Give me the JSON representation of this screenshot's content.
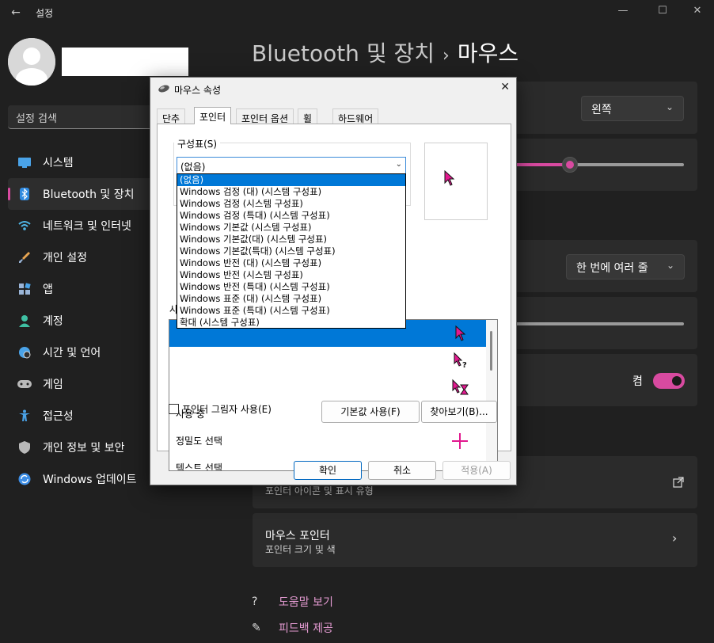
{
  "window": {
    "title": "설정",
    "back": "←",
    "controls": {
      "minimize": "—",
      "maximize": "☐",
      "close": "✕"
    }
  },
  "search": {
    "placeholder": "설정 검색"
  },
  "nav": {
    "items": [
      {
        "label": "시스템",
        "icon": "monitor-icon",
        "color": "#4aa3e8"
      },
      {
        "label": "Bluetooth 및 장치",
        "icon": "bluetooth-icon",
        "color": "#2f8ae0"
      },
      {
        "label": "네트워크 및 인터넷",
        "icon": "wifi-icon",
        "color": "#4fb7e8"
      },
      {
        "label": "개인 설정",
        "icon": "brush-icon",
        "color": "#e8a552"
      },
      {
        "label": "앱",
        "icon": "apps-icon",
        "color": "#9ab5d8"
      },
      {
        "label": "계정",
        "icon": "person-icon",
        "color": "#3fc0a3"
      },
      {
        "label": "시간 및 언어",
        "icon": "globe-clock-icon",
        "color": "#4aa3e8"
      },
      {
        "label": "게임",
        "icon": "gamepad-icon",
        "color": "#b9b9b9"
      },
      {
        "label": "접근성",
        "icon": "accessibility-icon",
        "color": "#4aa3e8"
      },
      {
        "label": "개인 정보 및 보안",
        "icon": "shield-icon",
        "color": "#b9b9b9"
      },
      {
        "label": "Windows 업데이트",
        "icon": "update-icon",
        "color": "#3d8ee6"
      }
    ],
    "active_index": 1
  },
  "page": {
    "crumb": "Bluetooth 및 장치",
    "separator": "›",
    "title": "마우스"
  },
  "settings": {
    "primary_button_value": "왼쪽",
    "pointer_speed": 0.33,
    "scroll_value": "한 번에 여러 줄",
    "toggle_label": "켬",
    "additional_sub": "포인터 아이콘 및 표시 유형",
    "mouse_pointer_title": "마우스 포인터",
    "mouse_pointer_sub": "포인터 크기 및 색"
  },
  "help": {
    "help_label": "도움말 보기",
    "feedback_label": "피드백 제공"
  },
  "dialog": {
    "title": "마우스 속성",
    "tabs": [
      "단추",
      "포인터",
      "포인터 옵션",
      "휠",
      "하드웨어"
    ],
    "active_tab": 1,
    "scheme_label": "구성표(S)",
    "scheme_value": "(없음)",
    "list_label_partial": "사",
    "scheme_options": [
      "(없음)",
      "Windows 검정 (대) (시스템 구성표)",
      "Windows 검정 (시스템 구성표)",
      "Windows 검정 (특대) (시스템 구성표)",
      "Windows 기본값 (시스템 구성표)",
      "Windows 기본값(대) (시스템 구성표)",
      "Windows 기본값(특대) (시스템 구성표)",
      "Windows 반전 (대) (시스템 구성표)",
      "Windows 반전 (시스템 구성표)",
      "Windows 반전 (특대) (시스템 구성표)",
      "Windows 표준 (대) (시스템 구성표)",
      "Windows 표준 (특대) (시스템 구성표)",
      "확대 (시스템 구성표)"
    ],
    "cursor_rows": [
      {
        "label": "",
        "icon": "arrow-cursor-icon"
      },
      {
        "label": "",
        "icon": "help-select-cursor-icon"
      },
      {
        "label": "",
        "icon": "working-background-cursor-icon"
      },
      {
        "label": "사용 중",
        "icon": "busy-hourglass-cursor-icon"
      },
      {
        "label": "정밀도 선택",
        "icon": "crosshair-cursor-icon"
      },
      {
        "label": "텍스트 선택",
        "icon": "text-select-cursor-icon"
      }
    ],
    "shadow_label": "포인터 그림자 사용(E)",
    "default_button": "기본값 사용(F)",
    "browse_button": "찾아보기(B)...",
    "ok_button": "확인",
    "cancel_button": "취소",
    "apply_button": "적용(A)",
    "cursor_color": "#e2198f"
  }
}
